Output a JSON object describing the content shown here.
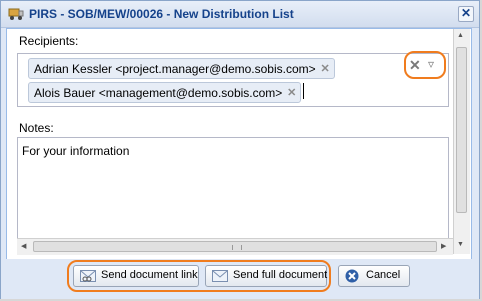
{
  "window": {
    "title": "PIRS - SOB/MEW/00026 - New Distribution List",
    "close_symbol": "✕"
  },
  "recipients": {
    "label": "Recipients:",
    "items": [
      {
        "text": "Adrian Kessler <project.manager@demo.sobis.com>"
      },
      {
        "text": "Alois Bauer <management@demo.sobis.com>"
      }
    ],
    "remove_symbol": "✕",
    "clear_symbol": "✕",
    "dropdown_symbol": "▿"
  },
  "notes": {
    "label": "Notes:",
    "value": "For your information"
  },
  "buttons": {
    "send_link": "Send document link",
    "send_full": "Send full document",
    "cancel": "Cancel"
  },
  "colors": {
    "highlight": "#f07c1e",
    "title_text": "#15428b"
  }
}
